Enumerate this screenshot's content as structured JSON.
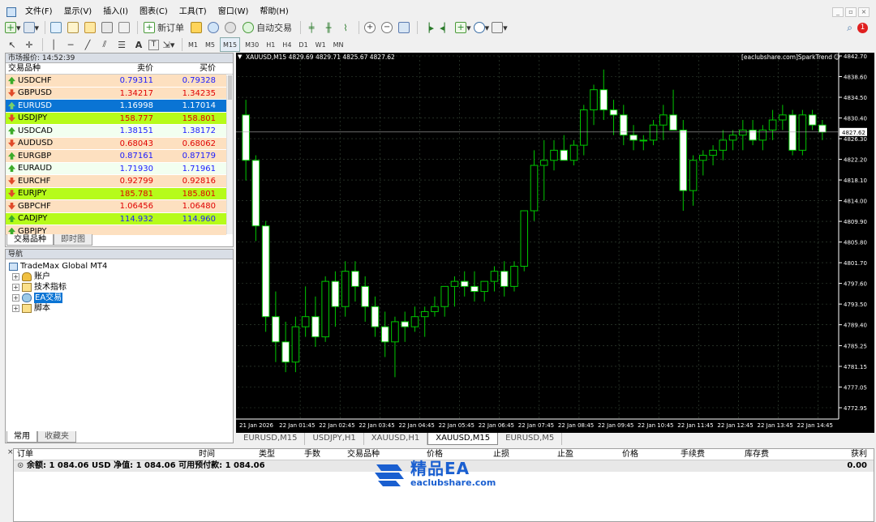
{
  "menu": {
    "items": [
      "文件(F)",
      "显示(V)",
      "插入(I)",
      "图表(C)",
      "工具(T)",
      "窗口(W)",
      "帮助(H)"
    ]
  },
  "toolbar": {
    "new_order": "新订单",
    "auto_trade": "自动交易",
    "timeframes": [
      "M1",
      "M5",
      "M15",
      "M30",
      "H1",
      "H4",
      "D1",
      "W1",
      "MN"
    ],
    "active_timeframe": "M15",
    "notification_count": "1"
  },
  "market_watch": {
    "title": "市场报价: 14:52:39",
    "col_symbol": "交易品种",
    "col_bid": "卖价",
    "col_ask": "买价",
    "rows": [
      {
        "symbol": "USDCHF",
        "bid": "0.79311",
        "ask": "0.79328",
        "bg": "#fde0c0",
        "color": "#1a1aff",
        "dir": "up"
      },
      {
        "symbol": "GBPUSD",
        "bid": "1.34217",
        "ask": "1.34235",
        "bg": "#fde0c0",
        "color": "#e00000",
        "dir": "down"
      },
      {
        "symbol": "EURUSD",
        "bid": "1.16998",
        "ask": "1.17014",
        "bg": "#0a74d4",
        "color": "#ffffff",
        "dir": "up",
        "selected": true
      },
      {
        "symbol": "USDJPY",
        "bid": "158.777",
        "ask": "158.801",
        "bg": "#b6fb1a",
        "color": "#e00000",
        "dir": "down"
      },
      {
        "symbol": "USDCAD",
        "bid": "1.38151",
        "ask": "1.38172",
        "bg": "#f2fff0",
        "color": "#1a1aff",
        "dir": "up"
      },
      {
        "symbol": "AUDUSD",
        "bid": "0.68043",
        "ask": "0.68062",
        "bg": "#fde0c0",
        "color": "#e00000",
        "dir": "down"
      },
      {
        "symbol": "EURGBP",
        "bid": "0.87161",
        "ask": "0.87179",
        "bg": "#fde0c0",
        "color": "#1a1aff",
        "dir": "up"
      },
      {
        "symbol": "EURAUD",
        "bid": "1.71930",
        "ask": "1.71961",
        "bg": "#f2fff0",
        "color": "#1a1aff",
        "dir": "up"
      },
      {
        "symbol": "EURCHF",
        "bid": "0.92799",
        "ask": "0.92816",
        "bg": "#fde0c0",
        "color": "#e00000",
        "dir": "down"
      },
      {
        "symbol": "EURJPY",
        "bid": "185.781",
        "ask": "185.801",
        "bg": "#b6fb1a",
        "color": "#e00000",
        "dir": "down"
      },
      {
        "symbol": "GBPCHF",
        "bid": "1.06456",
        "ask": "1.06480",
        "bg": "#fde0c0",
        "color": "#e00000",
        "dir": "down"
      },
      {
        "symbol": "CADJPY",
        "bid": "114.932",
        "ask": "114.960",
        "bg": "#b6fb1a",
        "color": "#1a1aff",
        "dir": "up"
      },
      {
        "symbol": "GBPJPY",
        "bid": "",
        "ask": "",
        "bg": "#fde0c0",
        "color": "#1a1aff",
        "dir": "up"
      }
    ],
    "tabs": [
      "交易品种",
      "即时图"
    ]
  },
  "navigator": {
    "title": "导航",
    "root": "TradeMax Global MT4",
    "items": [
      "账户",
      "技术指标",
      "EA交易",
      "脚本"
    ],
    "tabs": [
      "常用",
      "收藏夹"
    ]
  },
  "chart": {
    "header": "XAUUSD,M15  4829.69 4829.71 4825.67 4827.62",
    "brand": "[eaclubshare.com]SparkTrend",
    "current_price": "4827.62",
    "price_labels": [
      "4842.70",
      "4838.60",
      "4834.50",
      "4830.40",
      "4826.30",
      "4822.20",
      "4818.10",
      "4814.00",
      "4809.90",
      "4805.80",
      "4801.70",
      "4797.60",
      "4793.50",
      "4789.40",
      "4785.25",
      "4781.15",
      "4777.05",
      "4772.95"
    ],
    "time_labels": [
      "21 Jan 2026",
      "22 Jan 01:45",
      "22 Jan 02:45",
      "22 Jan 03:45",
      "22 Jan 04:45",
      "22 Jan 05:45",
      "22 Jan 06:45",
      "22 Jan 07:45",
      "22 Jan 08:45",
      "22 Jan 09:45",
      "22 Jan 10:45",
      "22 Jan 11:45",
      "22 Jan 12:45",
      "22 Jan 13:45",
      "22 Jan 14:45"
    ],
    "candles": [
      [
        4831,
        4834,
        4818,
        4822
      ],
      [
        4822,
        4823,
        4806,
        4809
      ],
      [
        4809,
        4810,
        4788,
        4791
      ],
      [
        4791,
        4796,
        4782,
        4786
      ],
      [
        4786,
        4790,
        4780,
        4782
      ],
      [
        4782,
        4791,
        4780,
        4789
      ],
      [
        4789,
        4797,
        4787,
        4791
      ],
      [
        4791,
        4795,
        4785,
        4787
      ],
      [
        4787,
        4799,
        4786,
        4798
      ],
      [
        4798,
        4800,
        4789,
        4793
      ],
      [
        4793,
        4802,
        4791,
        4800
      ],
      [
        4800,
        4802,
        4794,
        4797
      ],
      [
        4797,
        4799,
        4790,
        4793
      ],
      [
        4793,
        4795,
        4787,
        4789
      ],
      [
        4789,
        4792,
        4783,
        4786
      ],
      [
        4786,
        4791,
        4779,
        4790
      ],
      [
        4790,
        4792,
        4786,
        4789
      ],
      [
        4789,
        4793,
        4788,
        4791
      ],
      [
        4791,
        4793,
        4787,
        4792
      ],
      [
        4792,
        4795,
        4791,
        4793
      ],
      [
        4793,
        4797,
        4791,
        4797
      ],
      [
        4797,
        4799,
        4793,
        4798
      ],
      [
        4798,
        4800,
        4795,
        4797
      ],
      [
        4797,
        4800,
        4794,
        4796
      ],
      [
        4796,
        4798,
        4794,
        4798
      ],
      [
        4798,
        4801,
        4796,
        4800
      ],
      [
        4800,
        4802,
        4795,
        4797
      ],
      [
        4797,
        4802,
        4796,
        4801
      ],
      [
        4801,
        4812,
        4800,
        4812
      ],
      [
        4812,
        4824,
        4810,
        4821
      ],
      [
        4821,
        4826,
        4814,
        4822
      ],
      [
        4822,
        4826,
        4820,
        4824
      ],
      [
        4824,
        4827,
        4822,
        4822
      ],
      [
        4822,
        4826,
        4821,
        4825
      ],
      [
        4825,
        4833,
        4823,
        4832
      ],
      [
        4832,
        4837,
        4829,
        4836
      ],
      [
        4836,
        4840,
        4830,
        4832
      ],
      [
        4832,
        4834,
        4827,
        4831
      ],
      [
        4831,
        4833,
        4825,
        4827
      ],
      [
        4827,
        4829,
        4824,
        4826
      ],
      [
        4826,
        4827,
        4824,
        4826
      ],
      [
        4826,
        4830,
        4825,
        4829
      ],
      [
        4829,
        4833,
        4826,
        4831
      ],
      [
        4831,
        4836,
        4830,
        4828
      ],
      [
        4828,
        4830,
        4812,
        4816
      ],
      [
        4816,
        4823,
        4813,
        4822
      ],
      [
        4822,
        4824,
        4819,
        4823
      ],
      [
        4823,
        4825,
        4821,
        4824
      ],
      [
        4824,
        4828,
        4822,
        4826
      ],
      [
        4826,
        4828,
        4824,
        4827
      ],
      [
        4827,
        4830,
        4824,
        4828
      ],
      [
        4828,
        4830,
        4825,
        4826
      ],
      [
        4826,
        4829,
        4824,
        4828
      ],
      [
        4828,
        4832,
        4826,
        4830
      ],
      [
        4830,
        4833,
        4828,
        4831
      ],
      [
        4831,
        4832,
        4823,
        4824
      ],
      [
        4824,
        4832,
        4823,
        4831
      ],
      [
        4831,
        4832,
        4828,
        4829
      ],
      [
        4829,
        4830,
        4826,
        4827.6
      ]
    ],
    "colors": {
      "bg": "#000000",
      "grid": "#3a4a3a",
      "bull": "#000000",
      "bear": "#ffffff",
      "wick": "#00c800"
    }
  },
  "chart_tabs": {
    "items": [
      "EURUSD,M15",
      "USDJPY,H1",
      "XAUUSD,H1",
      "XAUUSD,M15",
      "EURUSD,M5"
    ],
    "active": "XAUUSD,M15"
  },
  "terminal": {
    "columns": [
      "订单",
      "时间",
      "类型",
      "手数",
      "交易品种",
      "价格",
      "止损",
      "止盈",
      "价格",
      "手续费",
      "库存费",
      "获利"
    ],
    "balance_text": "余额: 1 084.06 USD  净值: 1 084.06  可用预付款: 1 084.06",
    "profit": "0.00"
  },
  "watermark": {
    "brand": "精品EA",
    "url": "eaclubshare.com"
  }
}
